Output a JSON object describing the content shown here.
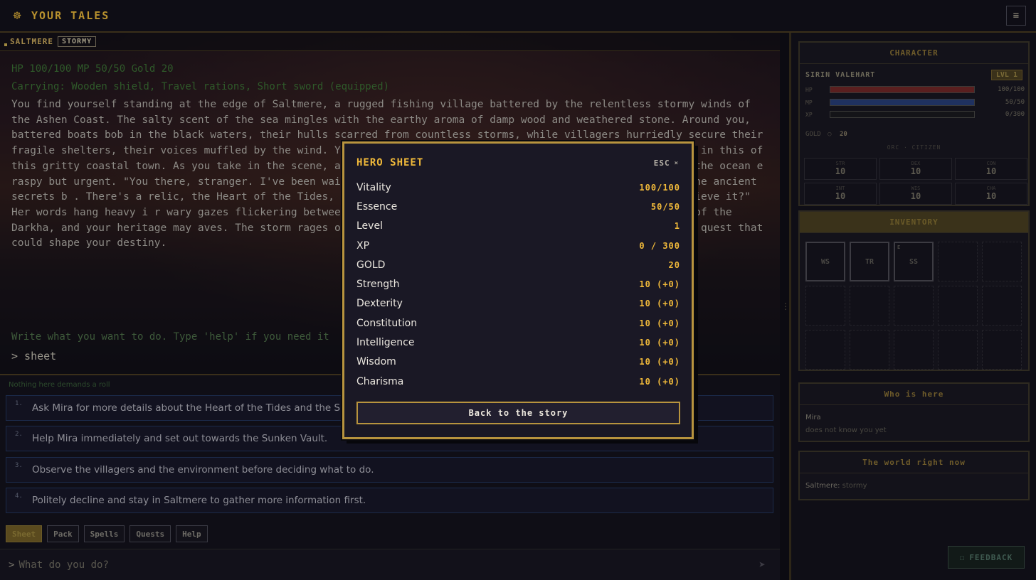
{
  "app": {
    "title": "YOUR TALES",
    "logo_icon": "☸",
    "menu_icon": "≡"
  },
  "location": {
    "name": "SALTMERE",
    "weather": "STORMY"
  },
  "story": {
    "status_line": "HP 100/100 MP 50/50 Gold 20",
    "carrying_line": "Carrying: Wooden shield, Travel rations, Short sword (equipped)",
    "paragraph": "You find yourself standing at the edge of Saltmere, a rugged fishing village battered by the relentless stormy winds of the Ashen Coast. The salty scent of the sea mingles with the earthy aroma of damp wood and weathered stone. Around you, battered boats bob in the black waters, their hulls scarred from countless storms, while villagers hurriedly secure their fragile shelters, their voices muffled by the wind. Y                                         the primal strength that courses through your veins, yet in this                                         of this gritty coastal town. As you take in the scene, a figu                                         ith sea-green eyes that seem to hold the depths of the ocean                                         e raspy but urgent. \"You there, stranger. I've been waiting for s                                         The Darkha's shadow grows nearer, and I fear the ancient secrets b                                         . There's a relic, the Heart of the Tides, hidden in the Sunken V                                         't go alone. Will you help me retrieve it?\" Her words hang heavy i                                         r wary gazes flickering between you and her. The first true call t                                         the creeping threat of the Darkha, and your heritage may                                         aves. The storm rages on behind her, but a flicker of hope igni                                         the whisper of a quest that could shape your destiny.",
    "prompt_hint": "Write what you want to do. Type 'help' if you need it",
    "command_echo": "> sheet"
  },
  "choices": {
    "no_roll": "Nothing here demands a roll",
    "items": [
      {
        "num": "1.",
        "text": "Ask Mira for more details about the Heart of the Tides and the Sunken"
      },
      {
        "num": "2.",
        "text": "Help Mira immediately and set out towards the Sunken Vault."
      },
      {
        "num": "3.",
        "text": "Observe the villagers and the environment before deciding what to do."
      },
      {
        "num": "4.",
        "text": "Politely decline and stay in Saltmere to gather more information first."
      }
    ]
  },
  "quick_buttons": [
    "Sheet",
    "Pack",
    "Spells",
    "Quests",
    "Help"
  ],
  "input": {
    "caret": ">",
    "placeholder": "What do you do?",
    "send_icon": "➤"
  },
  "character": {
    "panel_title": "CHARACTER",
    "name": "SIRIN VALEHART",
    "level_badge": "LVL 1",
    "hp_label": "HP",
    "hp_value": "100/100",
    "hp_fraction": 1.0,
    "mp_label": "MP",
    "mp_value": "50/50",
    "mp_fraction": 1.0,
    "xp_label": "XP",
    "xp_value": "0/300",
    "xp_fraction": 0.0,
    "gold_label": "GOLD",
    "gold_icon": "○",
    "gold_value": "20",
    "class_line": "ORC · CITIZEN",
    "stats": [
      {
        "key": "STR",
        "val": "10"
      },
      {
        "key": "DEX",
        "val": "10"
      },
      {
        "key": "CON",
        "val": "10"
      },
      {
        "key": "INT",
        "val": "10"
      },
      {
        "key": "WIS",
        "val": "10"
      },
      {
        "key": "CHA",
        "val": "10"
      }
    ],
    "colors": {
      "hp": "#5a1f1f",
      "mp": "#1f3160"
    }
  },
  "inventory": {
    "title": "INVENTORY",
    "slots": [
      "WS",
      "TR",
      "SS"
    ],
    "equipped_marker": "E"
  },
  "who_here": {
    "title": "Who is here",
    "name": "Mira",
    "status": "does not know you yet"
  },
  "world": {
    "title": "The world right now",
    "location": "Saltmere:",
    "weather": " stormy"
  },
  "feedback": {
    "icon": "☐",
    "label": "FEEDBACK"
  },
  "modal": {
    "title": "HERO SHEET",
    "esc_label": "ESC",
    "close_icon": "×",
    "rows": [
      {
        "label": "Vitality",
        "value": "100/100"
      },
      {
        "label": "Essence",
        "value": "50/50"
      },
      {
        "label": "Level",
        "value": "1"
      },
      {
        "label": "XP",
        "value": "0 / 300"
      },
      {
        "label": "GOLD",
        "value": "20"
      },
      {
        "label": "Strength",
        "value": "10 (+0)"
      },
      {
        "label": "Dexterity",
        "value": "10 (+0)"
      },
      {
        "label": "Constitution",
        "value": "10 (+0)"
      },
      {
        "label": "Intelligence",
        "value": "10 (+0)"
      },
      {
        "label": "Wisdom",
        "value": "10 (+0)"
      },
      {
        "label": "Charisma",
        "value": "10 (+0)"
      }
    ],
    "back_label": "Back to the story",
    "accent": "#f0b93a",
    "border": "#b8943e"
  }
}
